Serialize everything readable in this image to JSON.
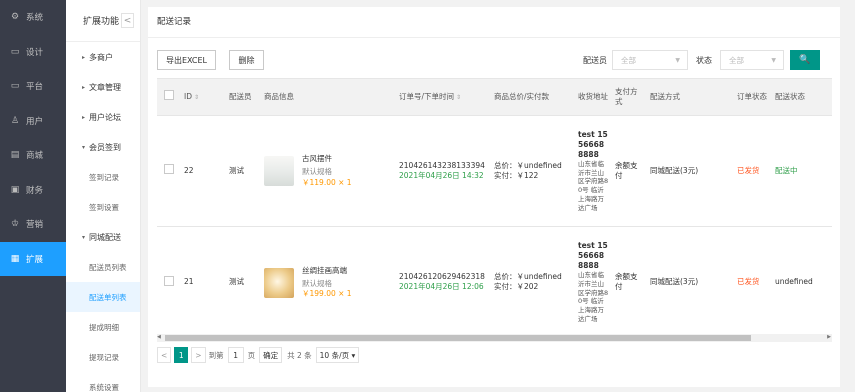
{
  "mainnav": [
    {
      "label": "系统",
      "icon": "gear-icon",
      "glyph": "⚙"
    },
    {
      "label": "设计",
      "icon": "monitor-icon",
      "glyph": "▭"
    },
    {
      "label": "平台",
      "icon": "desktop-icon",
      "glyph": "▭"
    },
    {
      "label": "用户",
      "icon": "user-icon",
      "glyph": "♙"
    },
    {
      "label": "商城",
      "icon": "shop-icon",
      "glyph": "▤"
    },
    {
      "label": "财务",
      "icon": "finance-icon",
      "glyph": "▣"
    },
    {
      "label": "营销",
      "icon": "gift-icon",
      "glyph": "♔"
    },
    {
      "label": "扩展",
      "icon": "grid-icon",
      "glyph": "▦"
    }
  ],
  "subnav": {
    "title": "扩展功能",
    "collapse_glyph": "<",
    "groups": [
      {
        "label": "多商户",
        "tri": "▸"
      },
      {
        "label": "文章管理",
        "tri": "▸"
      },
      {
        "label": "用户论坛",
        "tri": "▸"
      },
      {
        "label": "会员签到",
        "tri": "▾"
      }
    ],
    "signin_items": [
      "签到记录",
      "签到设置"
    ],
    "delivery_group": {
      "label": "同城配送",
      "tri": "▾"
    },
    "delivery_items": [
      "配送员列表",
      "配送单列表",
      "提成明细",
      "提现记录",
      "系统设置"
    ]
  },
  "page": {
    "title": "配送记录"
  },
  "toolbar": {
    "export_label": "导出EXCEL",
    "delete_label": "删除",
    "courier_label": "配送员",
    "courier_value": "全部",
    "status_label": "状态",
    "status_value": "全部",
    "search_glyph": "🔍"
  },
  "table": {
    "headers": {
      "id": "ID",
      "courier": "配送员",
      "goods": "商品信息",
      "order": "订单号/下单时间",
      "total": "商品总价/实付款",
      "address": "收货地址",
      "pay": "支付方式",
      "delivery": "配送方式",
      "order_status": "订单状态",
      "delivery_status": "配送状态"
    },
    "rows": [
      {
        "id": "22",
        "courier": "测试",
        "goods_name": "古风摆件",
        "goods_spec": "默认规格",
        "goods_price": "￥119.00 × 1",
        "order_no": "210426143238133394",
        "order_time": "2021年04月26日 14:32",
        "total": "总价：￥undefined",
        "paid": "实付：￥122",
        "addr_name": "test 15566688888",
        "addr_detail": "山东省临沂市兰山区学府路80号 临沂上海路万达广场",
        "pay": "余额支付",
        "delivery": "同城配送(3元)",
        "order_status": "已发货",
        "delivery_status": "配送中"
      },
      {
        "id": "21",
        "courier": "测试",
        "goods_name": "丝绸挂画高端",
        "goods_spec": "默认规格",
        "goods_price": "￥199.00 × 1",
        "order_no": "210426120629462318",
        "order_time": "2021年04月26日 12:06",
        "total": "总价：￥undefined",
        "paid": "实付：￥202",
        "addr_name": "test 15566688888",
        "addr_detail": "山东省临沂市兰山区学府路80号 临沂上海路万达广场",
        "pay": "余额支付",
        "delivery": "同城配送(3元)",
        "order_status": "已发货",
        "delivery_status": "undefined"
      }
    ]
  },
  "pager": {
    "prev": "<",
    "current": "1",
    "next": ">",
    "goto_label": "到第",
    "goto_value": "1",
    "page_unit": "页",
    "confirm": "确定",
    "total": "共 2 条",
    "per_page": "10 条/页"
  }
}
